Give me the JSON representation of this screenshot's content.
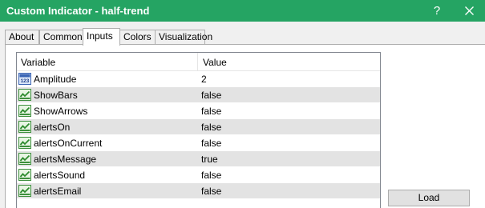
{
  "window": {
    "title": "Custom Indicator - half-trend",
    "help_label": "?",
    "title_bar_color": "#25a463"
  },
  "tabs": [
    {
      "label": "About",
      "active": false
    },
    {
      "label": "Common",
      "active": false
    },
    {
      "label": "Inputs",
      "active": true
    },
    {
      "label": "Colors",
      "active": false
    },
    {
      "label": "Visualization",
      "active": false
    }
  ],
  "inputs": {
    "columns": [
      "Variable",
      "Value"
    ],
    "rows": [
      {
        "name": "Amplitude",
        "value": "2",
        "icon": "integer-icon"
      },
      {
        "name": "ShowBars",
        "value": "false",
        "icon": "boolean-icon"
      },
      {
        "name": "ShowArrows",
        "value": "false",
        "icon": "boolean-icon"
      },
      {
        "name": "alertsOn",
        "value": "false",
        "icon": "boolean-icon"
      },
      {
        "name": "alertsOnCurrent",
        "value": "false",
        "icon": "boolean-icon"
      },
      {
        "name": "alertsMessage",
        "value": "true",
        "icon": "boolean-icon"
      },
      {
        "name": "alertsSound",
        "value": "false",
        "icon": "boolean-icon"
      },
      {
        "name": "alertsEmail",
        "value": "false",
        "icon": "boolean-icon"
      }
    ]
  },
  "buttons": {
    "load_label": "Load"
  }
}
